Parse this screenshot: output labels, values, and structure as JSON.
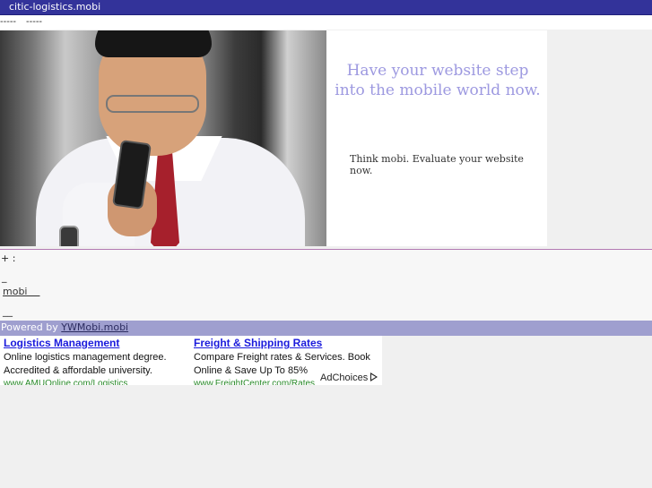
{
  "header": {
    "title": "citic-logistics.mobi"
  },
  "nav": {
    "item1": "-----",
    "item2": "-----"
  },
  "hero": {
    "headline": "Have your website step into the mobile world now.",
    "subtext": "Think mobi. Evaluate your website now."
  },
  "info": {
    "line1": "+    :",
    "line2": "_",
    "mobi_link": "mobi    ",
    "line4": "__"
  },
  "footer": {
    "powered_prefix": "Powered by ",
    "powered_link": "YWMobi.mobi"
  },
  "ads": [
    {
      "title": "Logistics Management",
      "desc1": "Online logistics management degree.",
      "desc2": "Accredited & affordable university.",
      "url": "www.AMUOnline.com/Logistics"
    },
    {
      "title": "Freight & Shipping Rates",
      "desc1": "Compare Freight rates & Services. Book",
      "desc2": "Online & Save Up To 85%",
      "url": "www.FreightCenter.com/Rates"
    }
  ],
  "adchoices": {
    "label": "AdChoices"
  },
  "colors": {
    "topbar": "#33339a",
    "powered_bar": "#9f9fcf",
    "headline": "#9d99e0",
    "ad_title": "#1a1adc",
    "ad_url": "#2a8a2a"
  }
}
